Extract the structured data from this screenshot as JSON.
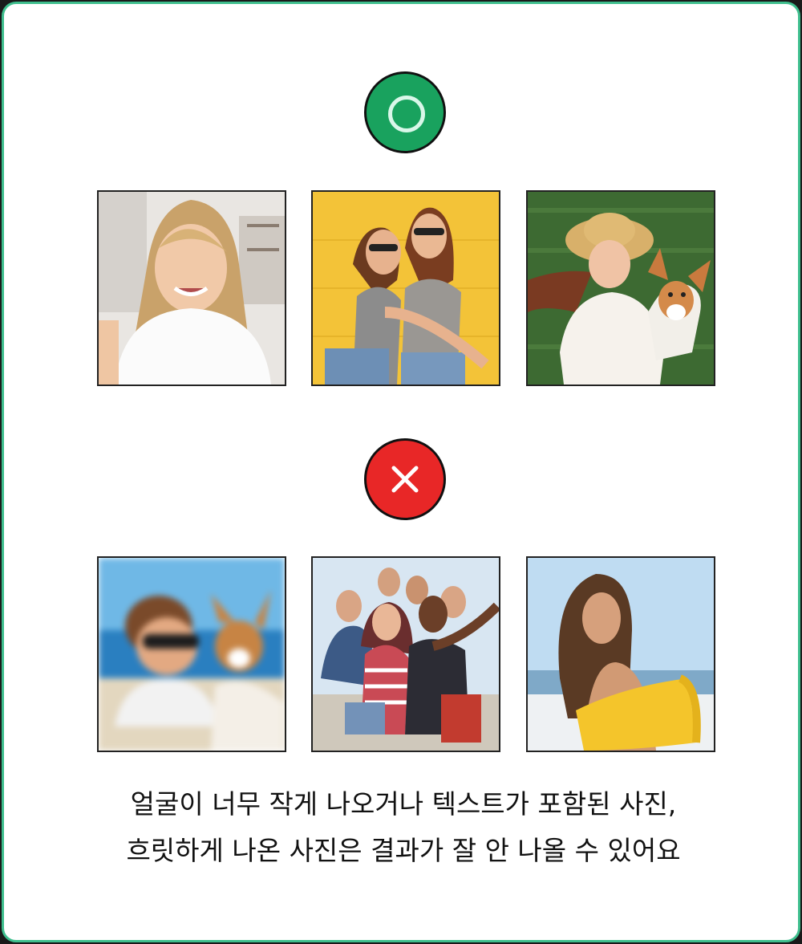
{
  "good_section": {
    "badge_icon": "check-circle-icon",
    "badge_color": "#19a25e",
    "photos": [
      {
        "name": "selfie-woman-photo"
      },
      {
        "name": "two-friends-yellow-wall-photo"
      },
      {
        "name": "girl-with-dog-on-grass-photo"
      }
    ]
  },
  "bad_section": {
    "badge_icon": "x-mark-icon",
    "badge_color": "#e82727",
    "photos": [
      {
        "name": "blurry-boy-with-dog-photo"
      },
      {
        "name": "group-of-friends-photo"
      },
      {
        "name": "woman-on-beach-photo"
      }
    ]
  },
  "caption": {
    "line1": "얼굴이 너무 작게 나오거나 텍스트가 포함된 사진,",
    "line2": "흐릿하게 나온 사진은 결과가 잘 안 나올 수 있어요"
  },
  "colors": {
    "accent_border": "#3fbf8e",
    "ok_green": "#19a25e",
    "ng_red": "#e82727"
  }
}
